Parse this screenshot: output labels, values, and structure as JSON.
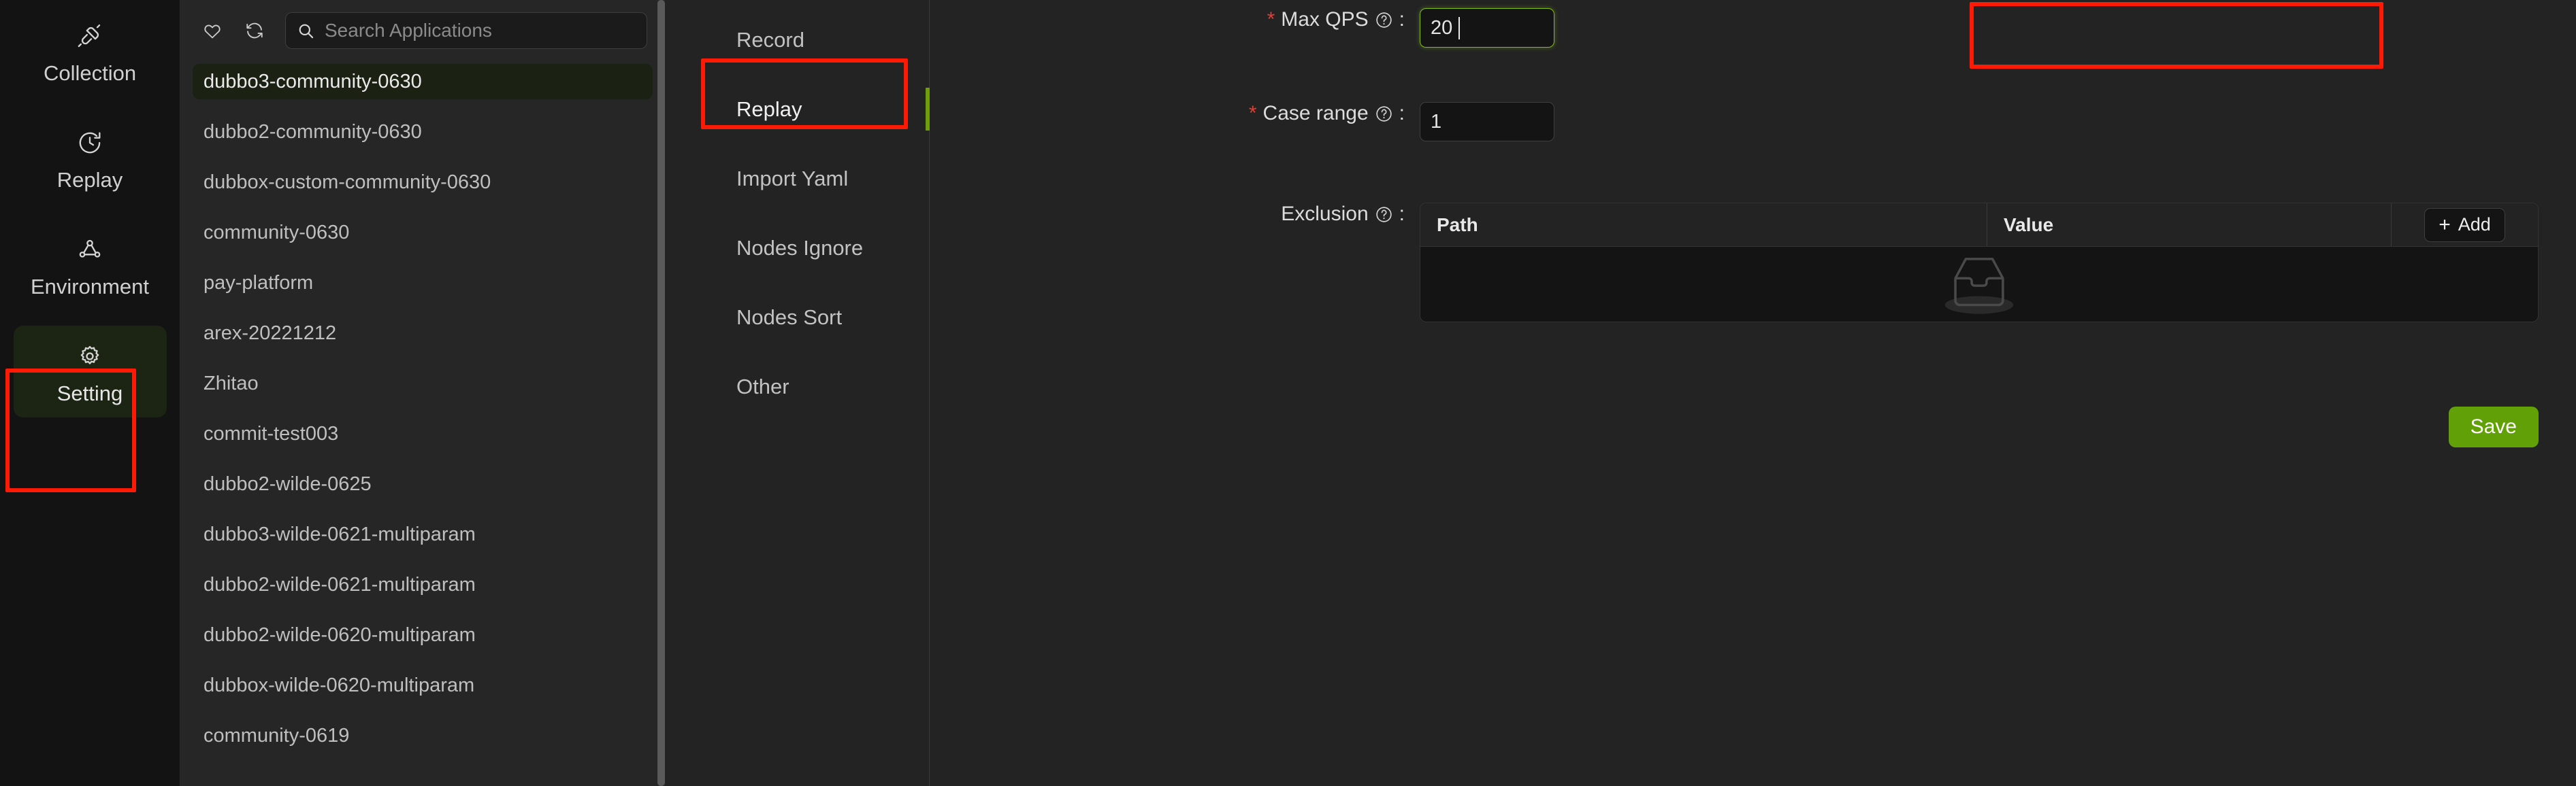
{
  "nav": {
    "items": [
      {
        "label": "Collection",
        "icon": "plug-icon",
        "active": false
      },
      {
        "label": "Replay",
        "icon": "history-clock-icon",
        "active": false
      },
      {
        "label": "Environment",
        "icon": "nodes-share-icon",
        "active": false
      },
      {
        "label": "Setting",
        "icon": "gear-icon",
        "active": true
      }
    ]
  },
  "applications": {
    "toolbar": {
      "favorite_icon": "heart-icon",
      "refresh_icon": "refresh-icon",
      "search_icon": "search-icon",
      "search_value": "",
      "search_placeholder": "Search Applications"
    },
    "items": [
      {
        "label": "dubbo3-community-0630",
        "selected": true
      },
      {
        "label": "dubbo2-community-0630",
        "selected": false
      },
      {
        "label": "dubbox-custom-community-0630",
        "selected": false
      },
      {
        "label": "community-0630",
        "selected": false
      },
      {
        "label": "pay-platform",
        "selected": false
      },
      {
        "label": "arex-20221212",
        "selected": false
      },
      {
        "label": "Zhitao",
        "selected": false
      },
      {
        "label": "commit-test003",
        "selected": false
      },
      {
        "label": "dubbo2-wilde-0625",
        "selected": false
      },
      {
        "label": "dubbo3-wilde-0621-multiparam",
        "selected": false
      },
      {
        "label": "dubbo2-wilde-0621-multiparam",
        "selected": false
      },
      {
        "label": "dubbo2-wilde-0620-multiparam",
        "selected": false
      },
      {
        "label": "dubbox-wilde-0620-multiparam",
        "selected": false
      },
      {
        "label": "community-0619",
        "selected": false
      }
    ]
  },
  "settings_menu": {
    "items": [
      {
        "label": "Record",
        "active": false
      },
      {
        "label": "Replay",
        "active": true
      },
      {
        "label": "Import Yaml",
        "active": false
      },
      {
        "label": "Nodes Ignore",
        "active": false
      },
      {
        "label": "Nodes Sort",
        "active": false
      },
      {
        "label": "Other",
        "active": false
      }
    ]
  },
  "form": {
    "max_qps": {
      "label": "Max QPS",
      "required_marker": "*",
      "help_icon": "question-circle-icon",
      "colon": ":",
      "value": "20",
      "focused": true
    },
    "case_range": {
      "label": "Case range",
      "required_marker": "*",
      "help_icon": "question-circle-icon",
      "colon": ":",
      "value": "1",
      "focused": false
    },
    "exclusion": {
      "label": "Exclusion",
      "help_icon": "question-circle-icon",
      "colon": ":",
      "columns": [
        "Path",
        "Value"
      ],
      "add_button": {
        "label": "Add",
        "icon": "plus-icon"
      },
      "rows": [],
      "empty_icon": "empty-inbox-icon"
    },
    "save_button": {
      "label": "Save"
    }
  },
  "colors": {
    "accent_green": "#6f9e0d",
    "save_green": "#62a007",
    "annotation_red": "#ff1a05",
    "required_red": "#d4443a",
    "focus_green": "#80b91a",
    "panel_bg": "#232323",
    "list_bg": "#262626",
    "nav_bg": "#131313",
    "table_body_bg": "#141414",
    "selected_bg": "#1b2113"
  },
  "annotations": [
    {
      "name": "setting-highlight",
      "target": "Setting"
    },
    {
      "name": "replay-highlight",
      "target": "Replay"
    },
    {
      "name": "max-qps-highlight",
      "target": "Max QPS"
    }
  ]
}
